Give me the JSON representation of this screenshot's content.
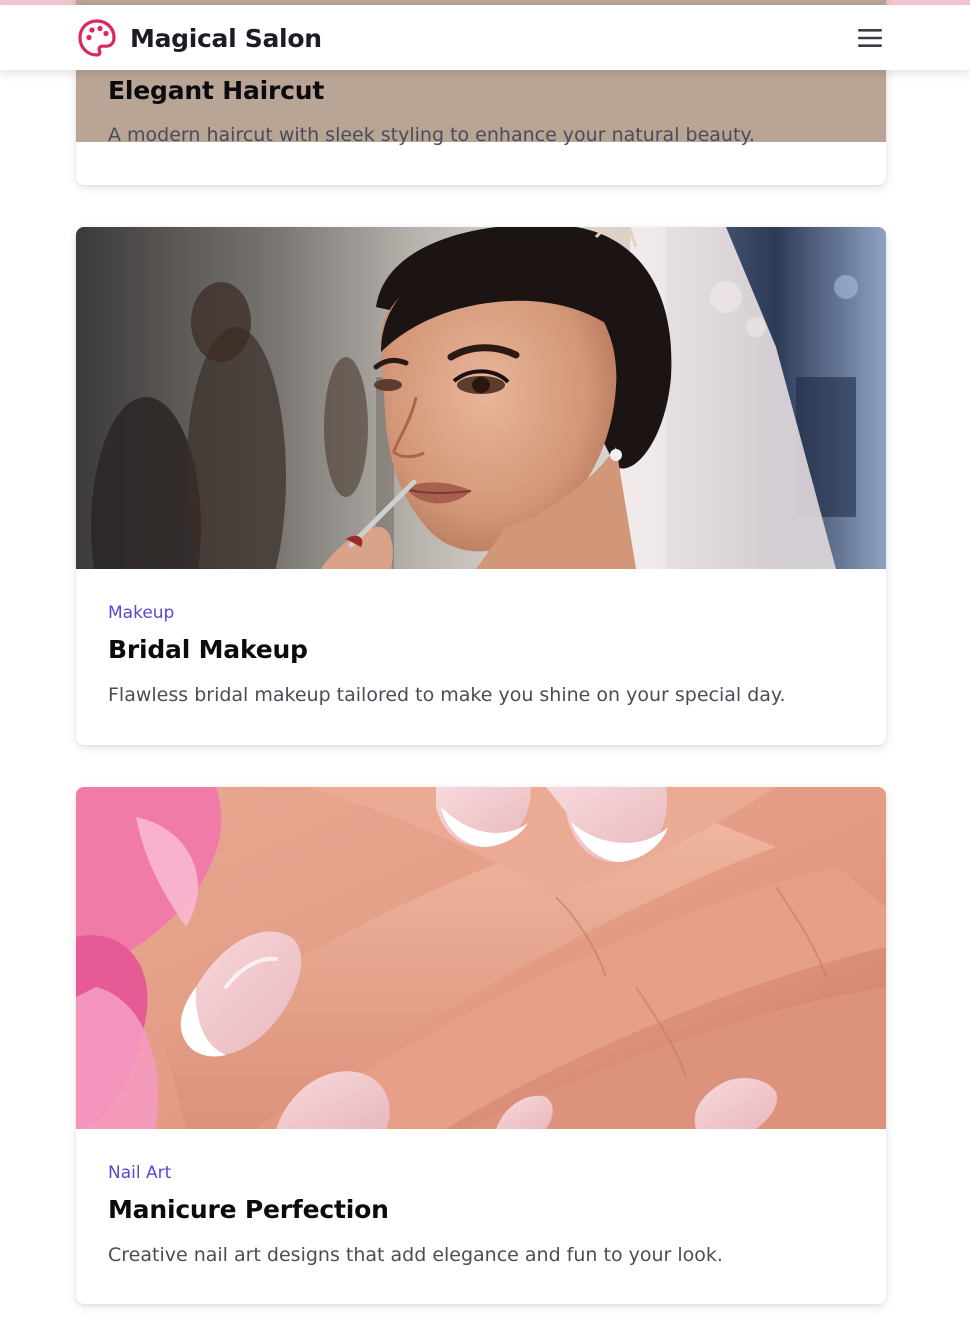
{
  "header": {
    "brand_name": "Magical Salon",
    "brand_icon": "palette-icon",
    "menu_icon": "hamburger-menu-icon"
  },
  "colors": {
    "brand_accent": "#e0245e",
    "category_text": "#5b47d6",
    "top_accent": "#f6c6d2"
  },
  "services": [
    {
      "title": "Elegant Haircut",
      "description": "A modern haircut with sleek styling to enhance your natural beauty."
    },
    {
      "category": "Makeup",
      "title": "Bridal Makeup",
      "description": "Flawless bridal makeup tailored to make you shine on your special day.",
      "image": "bride-lipstick-photo"
    },
    {
      "category": "Nail Art",
      "title": "Manicure Perfection",
      "description": "Creative nail art designs that add elegance and fun to your look.",
      "image": "french-manicure-photo"
    }
  ]
}
